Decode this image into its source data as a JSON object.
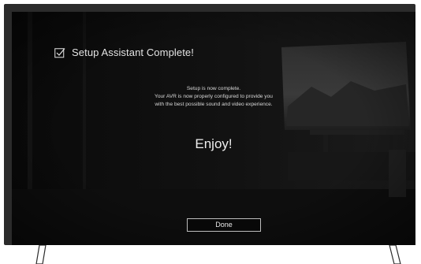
{
  "dialog": {
    "title": "Setup Assistant Complete!",
    "title_icon": "checkbox-checked-icon",
    "message_lines": [
      "Setup is now complete.",
      "Your AVR is now properly configured to provide you",
      "with the best possible sound and video experience."
    ],
    "headline": "Enjoy!",
    "done_label": "Done"
  },
  "colors": {
    "bezel": "#2b2b2b",
    "screen": "#0c0c0c",
    "text": "#e4e4e4",
    "button_border": "#bdbdbd"
  }
}
